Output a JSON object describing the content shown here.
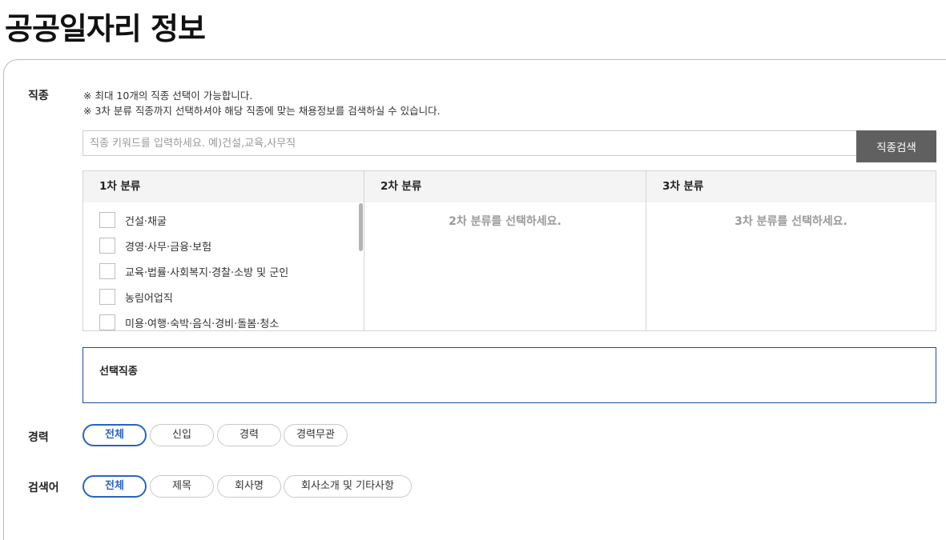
{
  "page": {
    "title": "공공일자리 정보"
  },
  "job_type": {
    "label": "직종",
    "notice_1": "※ 최대 10개의 직종 선택이 가능합니다.",
    "notice_2": "※ 3차 분류 직종까지 선택하셔야 해당 직종에 맞는 채용정보를 검색하실 수 있습니다.",
    "search_placeholder": "직종 키워드를 입력하세요. 예)건설,교육,사무직",
    "search_value": "",
    "search_button": "직종검색",
    "columns": [
      {
        "header": "1차 분류"
      },
      {
        "header": "2차 분류",
        "placeholder": "2차 분류를 선택하세요."
      },
      {
        "header": "3차 분류",
        "placeholder": "3차 분류를 선택하세요."
      }
    ],
    "level1_items": [
      "건설·채굴",
      "경영·사무·금융·보험",
      "교육·법률·사회복지·경찰·소방 및 군인",
      "농림어업직",
      "미용·여행·숙박·음식·경비·돌봄·청소"
    ],
    "selected_title": "선택직종"
  },
  "career": {
    "label": "경력",
    "options": [
      "전체",
      "신입",
      "경력",
      "경력무관"
    ],
    "selected": "전체"
  },
  "keyword": {
    "label": "검색어",
    "options": [
      "전체",
      "제목",
      "회사명",
      "회사소개 및 기타사항"
    ],
    "selected": "전체"
  },
  "colors": {
    "accent": "#2a63c0",
    "button_bg": "#606060",
    "border": "#1f4e8c"
  }
}
